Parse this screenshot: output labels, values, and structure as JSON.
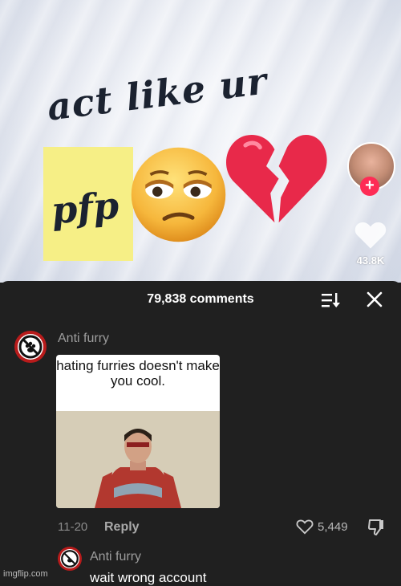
{
  "video": {
    "caption_line1": "act like ur",
    "caption_line2": "pfp",
    "like_count": "43.8K",
    "follow_label": "+",
    "icons": [
      "face-with-rolling-eyes-emoji",
      "broken-heart-emoji",
      "heart-icon"
    ]
  },
  "comments_panel": {
    "title": "79,838 comments",
    "sort_icon": "sort-icon",
    "close_icon": "close-icon"
  },
  "comments": [
    {
      "username": "Anti furry",
      "image_text": "hating furries doesn't make you cool.",
      "date": "11-20",
      "reply_label": "Reply",
      "likes": "5,449"
    },
    {
      "username": "Anti furry",
      "text": "wait wrong account"
    }
  ],
  "watermark": "imgflip.com",
  "colors": {
    "accent": "#fe2c55",
    "panel_bg": "#202020",
    "sticky": "#f6ef86"
  }
}
